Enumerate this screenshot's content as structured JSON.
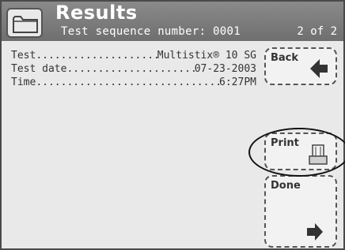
{
  "header": {
    "title": "Results",
    "subtitle": "Test sequence number: 0001",
    "page": "2 of 2",
    "icon": "folder-icon"
  },
  "details": {
    "test_label": "Test",
    "test_value": "Multistix® 10 SG",
    "date_label": "Test date",
    "date_value": "07-23-2003",
    "time_label": "Time",
    "time_value": "6:27PM"
  },
  "buttons": {
    "back": "Back",
    "print": "Print",
    "done": "Done"
  },
  "colors": {
    "header": "#6f6f6f",
    "screen": "#e9e9e9"
  }
}
